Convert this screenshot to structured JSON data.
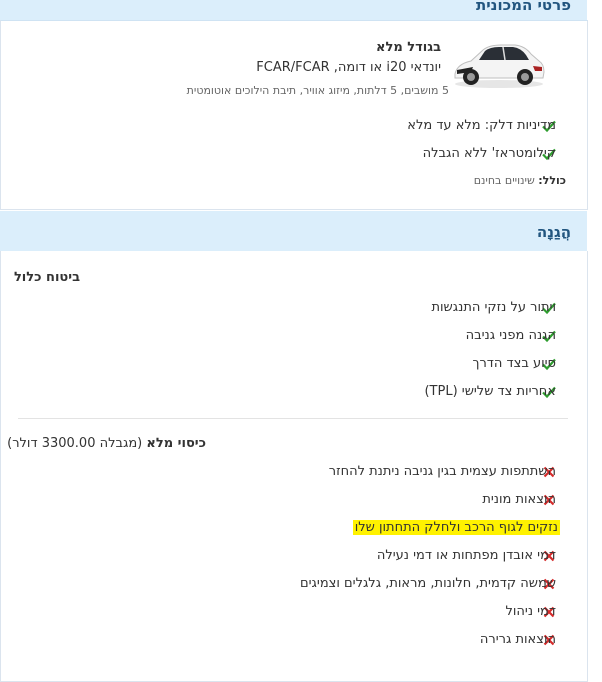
{
  "car_section": {
    "header": "פרטי המכונית",
    "size_label": "בגודל מלא",
    "model": "יונדאי i20 או דומה, FCAR/FCAR",
    "specs": "5 מושבים, 5 דלתות, מיזוג אוויר, תיבת הילוכים אוטומטית",
    "features": [
      "מדיניות דלק: מלא עד מלא",
      "קילומטראז' ללא הגבלה"
    ],
    "includes_label": "כולל:",
    "includes_value": "שינויים בחינם"
  },
  "protection_section": {
    "header": "הֲגַנָה",
    "insurance_title": "ביטוח כלול",
    "included": [
      "ויתור על נזקי התנגשות",
      "הגנה מפני גניבה",
      "סיוע בצד הדרך",
      "אחריות צד שלישי (TPL)"
    ],
    "full_cover_title": "כיסוי מלא",
    "full_cover_limit": "(מגבלה 3300.00 דולר)",
    "excluded": [
      "השתתפות עצמית בגין גניבה ניתנת להחזר",
      "הוצאות מונית",
      "נזקים לגוף הרכב ולחלק התחתון שלו",
      "דמי אובדן מפתחות או דמי נעילה",
      "שמשה קדמית, חלונות, מראות, גלגלים וצמיגים",
      "דמי ניהול",
      "הוצאות גרירה"
    ]
  },
  "colors": {
    "header_bg": "#dbeefb",
    "header_text": "#21557f",
    "check": "#2e9d2e",
    "cross": "#d42b2b",
    "highlight": "#fff200"
  },
  "icons": {
    "included": "checkmark-icon",
    "excluded": "cross-icon"
  }
}
